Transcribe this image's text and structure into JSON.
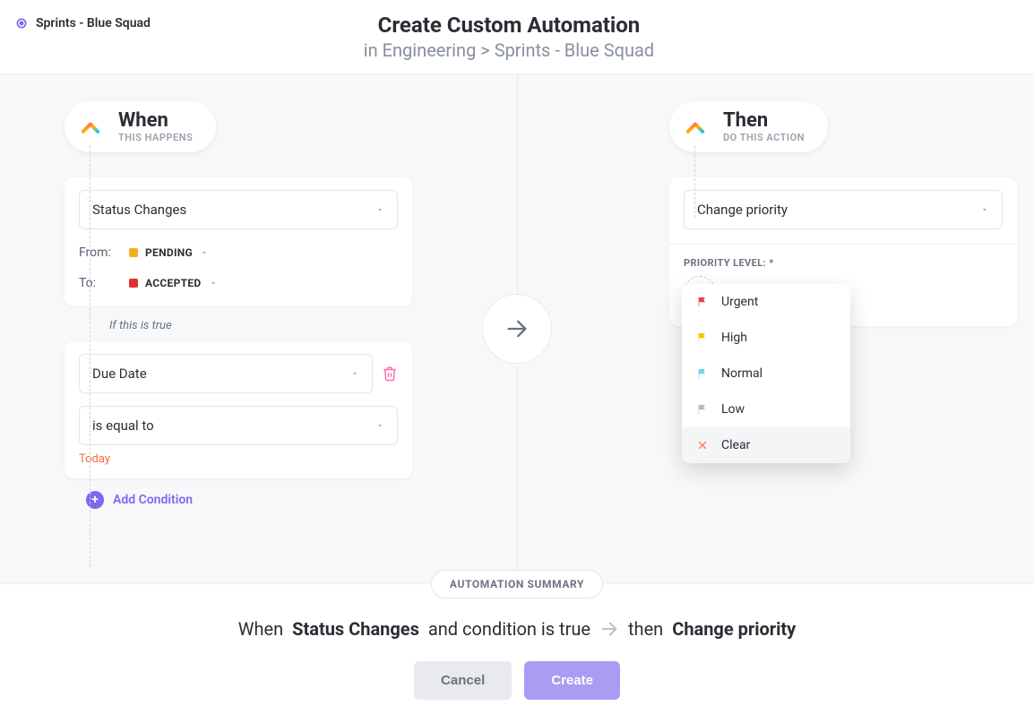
{
  "location": "Sprints - Blue Squad",
  "header": {
    "title": "Create Custom Automation",
    "subtitle_prefix": "in ",
    "subtitle_path": "Engineering > Sprints - Blue Squad"
  },
  "when": {
    "title": "When",
    "subtitle": "THIS HAPPENS",
    "trigger": "Status Changes",
    "from_label": "From:",
    "from_status": {
      "name": "PENDING",
      "color": "#f2b01e"
    },
    "to_label": "To:",
    "to_status": {
      "name": "ACCEPTED",
      "color": "#e02f2f"
    },
    "condition_intro": "If this is true",
    "condition_field": "Due Date",
    "condition_op": "is equal to",
    "condition_value": "Today",
    "add_condition": "Add Condition"
  },
  "then": {
    "title": "Then",
    "subtitle": "DO THIS ACTION",
    "action": "Change priority",
    "priority_label": "PRIORITY LEVEL: *",
    "options": [
      {
        "name": "Urgent",
        "color": "#f53f3f"
      },
      {
        "name": "High",
        "color": "#f7c600"
      },
      {
        "name": "Normal",
        "color": "#6fd4f5"
      },
      {
        "name": "Low",
        "color": "#b4bac4"
      },
      {
        "name": "Clear",
        "color": "#f6885e",
        "clear": true
      }
    ]
  },
  "summary": {
    "badge": "AUTOMATION SUMMARY",
    "when_word": "When",
    "trigger": "Status Changes",
    "middle": "and condition is true",
    "then_word": "then",
    "action": "Change priority"
  },
  "buttons": {
    "cancel": "Cancel",
    "create": "Create"
  }
}
